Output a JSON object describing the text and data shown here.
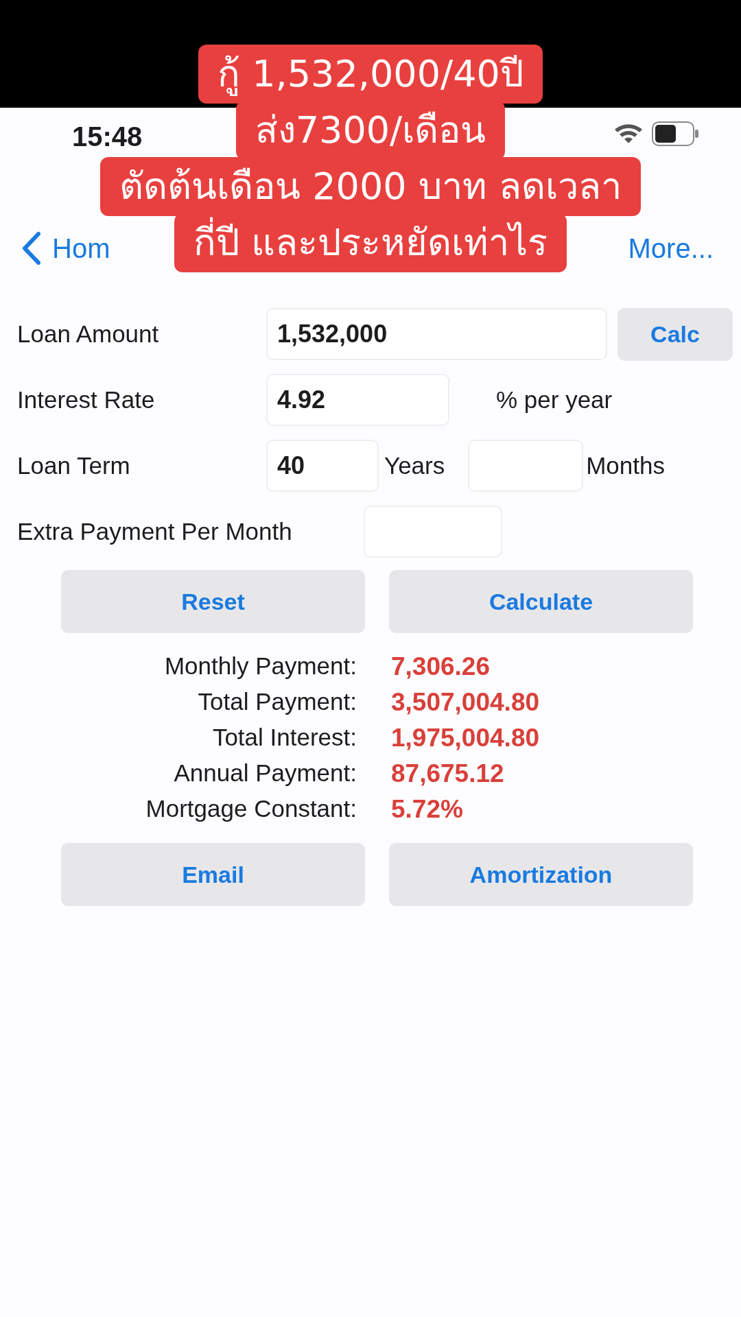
{
  "captions": [
    "กู้ 1,532,000/40ปี",
    "ส่ง7300/เดือน",
    "ตัดต้นเดือน 2000 บาท ลดเวลา",
    "กี่ปี และประหยัดเท่าไร"
  ],
  "status_bar": {
    "time": "15:48"
  },
  "nav": {
    "back": "Hom",
    "more": "More..."
  },
  "form": {
    "loan_amount": {
      "label": "Loan Amount",
      "value": "1,532,000",
      "button": "Calc"
    },
    "interest_rate": {
      "label": "Interest Rate",
      "value": "4.92",
      "unit": "% per year"
    },
    "loan_term": {
      "label": "Loan Term",
      "years": "40",
      "years_unit": "Years",
      "months_unit": "Months"
    },
    "extra_payment": {
      "label": "Extra Payment Per Month"
    }
  },
  "buttons_top": [
    "Reset",
    "Calculate"
  ],
  "results": [
    {
      "label": "Monthly Payment:",
      "value": "7,306.26"
    },
    {
      "label": "Total Payment:",
      "value": "3,507,004.80"
    },
    {
      "label": "Total Interest:",
      "value": "1,975,004.80"
    },
    {
      "label": "Annual Payment:",
      "value": "87,675.12"
    },
    {
      "label": "Mortgage Constant:",
      "value": "5.72%"
    }
  ],
  "buttons_bottom": [
    "Email",
    "Amortization"
  ]
}
